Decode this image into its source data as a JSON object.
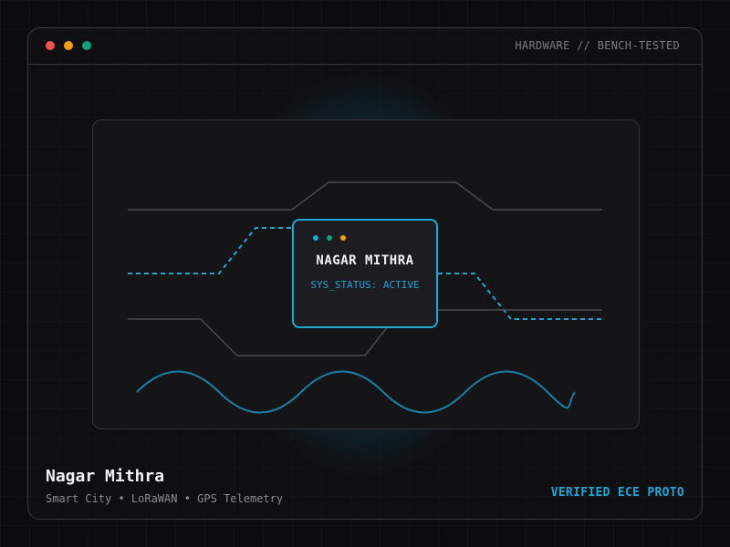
{
  "window": {
    "tag": "HARDWARE // BENCH-TESTED",
    "controls": [
      "close",
      "minimize",
      "maximize"
    ]
  },
  "chip": {
    "title": "NAGAR MITHRA",
    "status": "SYS_STATUS: ACTIVE"
  },
  "project": {
    "title": "Nagar Mithra",
    "subtitle": "Smart City • LoRaWAN • GPS Telemetry",
    "badge": "VERIFIED ECE PROTO"
  },
  "colors": {
    "accent": "#1fa7d6",
    "close": "#f05252",
    "minimize": "#f59e0b",
    "maximize": "#10a37f",
    "background": "#0c0c0e"
  }
}
